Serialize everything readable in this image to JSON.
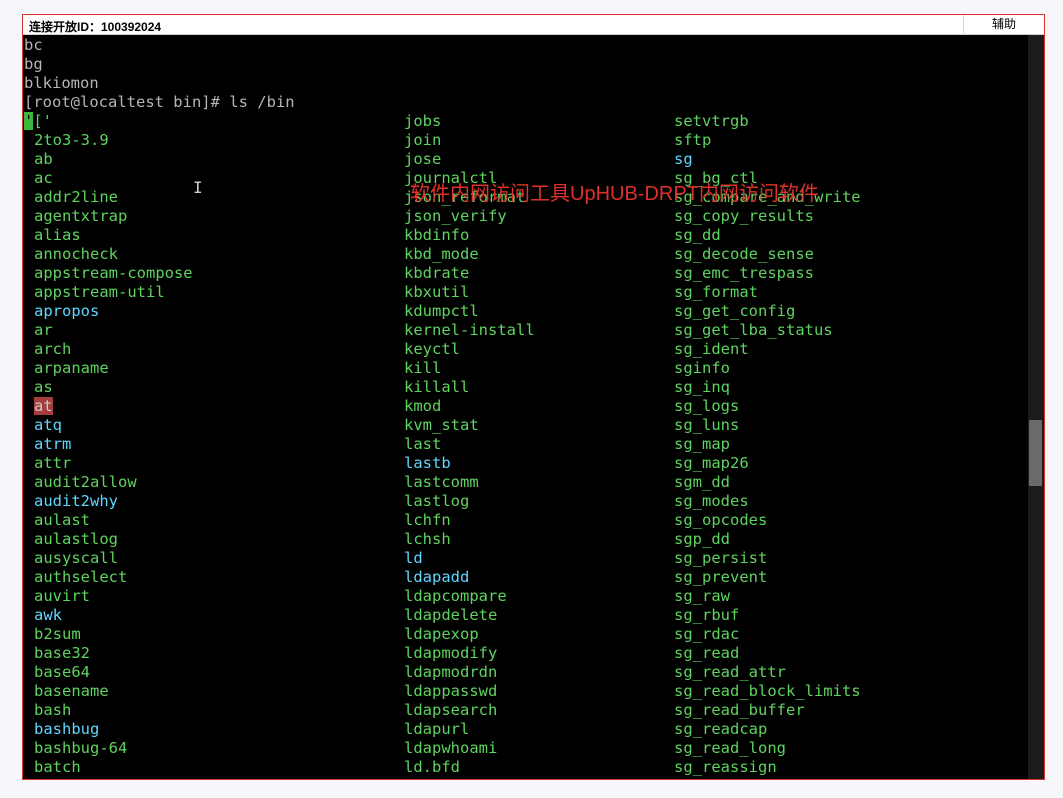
{
  "window": {
    "title": "连接开放ID：100392024",
    "assist_label": "辅助"
  },
  "watermark": "软件内网访问工具UpHUB-DRPT内网访问软件",
  "terminal": {
    "prev_lines": [
      "bc",
      "bg",
      "blkiomon"
    ],
    "prompt": "[root@localtest bin]# ls /bin",
    "first_entry_cursor": "'",
    "first_entry_rest": "['",
    "col1": [
      {
        "t": "2to3-3.9",
        "c": "green"
      },
      {
        "t": "ab",
        "c": "green"
      },
      {
        "t": "ac",
        "c": "green"
      },
      {
        "t": "addr2line",
        "c": "green"
      },
      {
        "t": "agentxtrap",
        "c": "green"
      },
      {
        "t": "alias",
        "c": "green"
      },
      {
        "t": "annocheck",
        "c": "green"
      },
      {
        "t": "appstream-compose",
        "c": "green"
      },
      {
        "t": "appstream-util",
        "c": "green"
      },
      {
        "t": "apropos",
        "c": "cyan"
      },
      {
        "t": "ar",
        "c": "green"
      },
      {
        "t": "arch",
        "c": "green"
      },
      {
        "t": "arpaname",
        "c": "green"
      },
      {
        "t": "as",
        "c": "green"
      },
      {
        "t": "at",
        "c": "hl"
      },
      {
        "t": "atq",
        "c": "cyan"
      },
      {
        "t": "atrm",
        "c": "cyan"
      },
      {
        "t": "attr",
        "c": "green"
      },
      {
        "t": "audit2allow",
        "c": "green"
      },
      {
        "t": "audit2why",
        "c": "cyan"
      },
      {
        "t": "aulast",
        "c": "green"
      },
      {
        "t": "aulastlog",
        "c": "green"
      },
      {
        "t": "ausyscall",
        "c": "green"
      },
      {
        "t": "authselect",
        "c": "green"
      },
      {
        "t": "auvirt",
        "c": "green"
      },
      {
        "t": "awk",
        "c": "cyan"
      },
      {
        "t": "b2sum",
        "c": "green"
      },
      {
        "t": "base32",
        "c": "green"
      },
      {
        "t": "base64",
        "c": "green"
      },
      {
        "t": "basename",
        "c": "green"
      },
      {
        "t": "bash",
        "c": "green"
      },
      {
        "t": "bashbug",
        "c": "cyan"
      },
      {
        "t": "bashbug-64",
        "c": "green"
      },
      {
        "t": "batch",
        "c": "green"
      }
    ],
    "col2": [
      {
        "t": "jobs",
        "c": "green"
      },
      {
        "t": "join",
        "c": "green"
      },
      {
        "t": "jose",
        "c": "green"
      },
      {
        "t": "journalctl",
        "c": "green"
      },
      {
        "t": "json_reformat",
        "c": "green"
      },
      {
        "t": "json_verify",
        "c": "green"
      },
      {
        "t": "kbdinfo",
        "c": "green"
      },
      {
        "t": "kbd_mode",
        "c": "green"
      },
      {
        "t": "kbdrate",
        "c": "green"
      },
      {
        "t": "kbxutil",
        "c": "green"
      },
      {
        "t": "kdumpctl",
        "c": "green"
      },
      {
        "t": "kernel-install",
        "c": "green"
      },
      {
        "t": "keyctl",
        "c": "green"
      },
      {
        "t": "kill",
        "c": "green"
      },
      {
        "t": "killall",
        "c": "green"
      },
      {
        "t": "kmod",
        "c": "green"
      },
      {
        "t": "kvm_stat",
        "c": "green"
      },
      {
        "t": "last",
        "c": "green"
      },
      {
        "t": "lastb",
        "c": "cyan"
      },
      {
        "t": "lastcomm",
        "c": "green"
      },
      {
        "t": "lastlog",
        "c": "green"
      },
      {
        "t": "lchfn",
        "c": "green"
      },
      {
        "t": "lchsh",
        "c": "green"
      },
      {
        "t": "ld",
        "c": "cyan"
      },
      {
        "t": "ldapadd",
        "c": "cyan"
      },
      {
        "t": "ldapcompare",
        "c": "green"
      },
      {
        "t": "ldapdelete",
        "c": "green"
      },
      {
        "t": "ldapexop",
        "c": "green"
      },
      {
        "t": "ldapmodify",
        "c": "green"
      },
      {
        "t": "ldapmodrdn",
        "c": "green"
      },
      {
        "t": "ldappasswd",
        "c": "green"
      },
      {
        "t": "ldapsearch",
        "c": "green"
      },
      {
        "t": "ldapurl",
        "c": "green"
      },
      {
        "t": "ldapwhoami",
        "c": "green"
      },
      {
        "t": "ld.bfd",
        "c": "green"
      }
    ],
    "col3": [
      {
        "t": "setvtrgb",
        "c": "green"
      },
      {
        "t": "sftp",
        "c": "green"
      },
      {
        "t": "sg",
        "c": "cyan"
      },
      {
        "t": "sg_bg_ctl",
        "c": "green"
      },
      {
        "t": "sg_compare_and_write",
        "c": "green"
      },
      {
        "t": "sg_copy_results",
        "c": "green"
      },
      {
        "t": "sg_dd",
        "c": "green"
      },
      {
        "t": "sg_decode_sense",
        "c": "green"
      },
      {
        "t": "sg_emc_trespass",
        "c": "green"
      },
      {
        "t": "sg_format",
        "c": "green"
      },
      {
        "t": "sg_get_config",
        "c": "green"
      },
      {
        "t": "sg_get_lba_status",
        "c": "green"
      },
      {
        "t": "sg_ident",
        "c": "green"
      },
      {
        "t": "sginfo",
        "c": "green"
      },
      {
        "t": "sg_inq",
        "c": "green"
      },
      {
        "t": "sg_logs",
        "c": "green"
      },
      {
        "t": "sg_luns",
        "c": "green"
      },
      {
        "t": "sg_map",
        "c": "green"
      },
      {
        "t": "sg_map26",
        "c": "green"
      },
      {
        "t": "sgm_dd",
        "c": "green"
      },
      {
        "t": "sg_modes",
        "c": "green"
      },
      {
        "t": "sg_opcodes",
        "c": "green"
      },
      {
        "t": "sgp_dd",
        "c": "green"
      },
      {
        "t": "sg_persist",
        "c": "green"
      },
      {
        "t": "sg_prevent",
        "c": "green"
      },
      {
        "t": "sg_raw",
        "c": "green"
      },
      {
        "t": "sg_rbuf",
        "c": "green"
      },
      {
        "t": "sg_rdac",
        "c": "green"
      },
      {
        "t": "sg_read",
        "c": "green"
      },
      {
        "t": "sg_read_attr",
        "c": "green"
      },
      {
        "t": "sg_read_block_limits",
        "c": "green"
      },
      {
        "t": "sg_read_buffer",
        "c": "green"
      },
      {
        "t": "sg_readcap",
        "c": "green"
      },
      {
        "t": "sg_read_long",
        "c": "green"
      },
      {
        "t": "sg_reassign",
        "c": "green"
      }
    ]
  }
}
